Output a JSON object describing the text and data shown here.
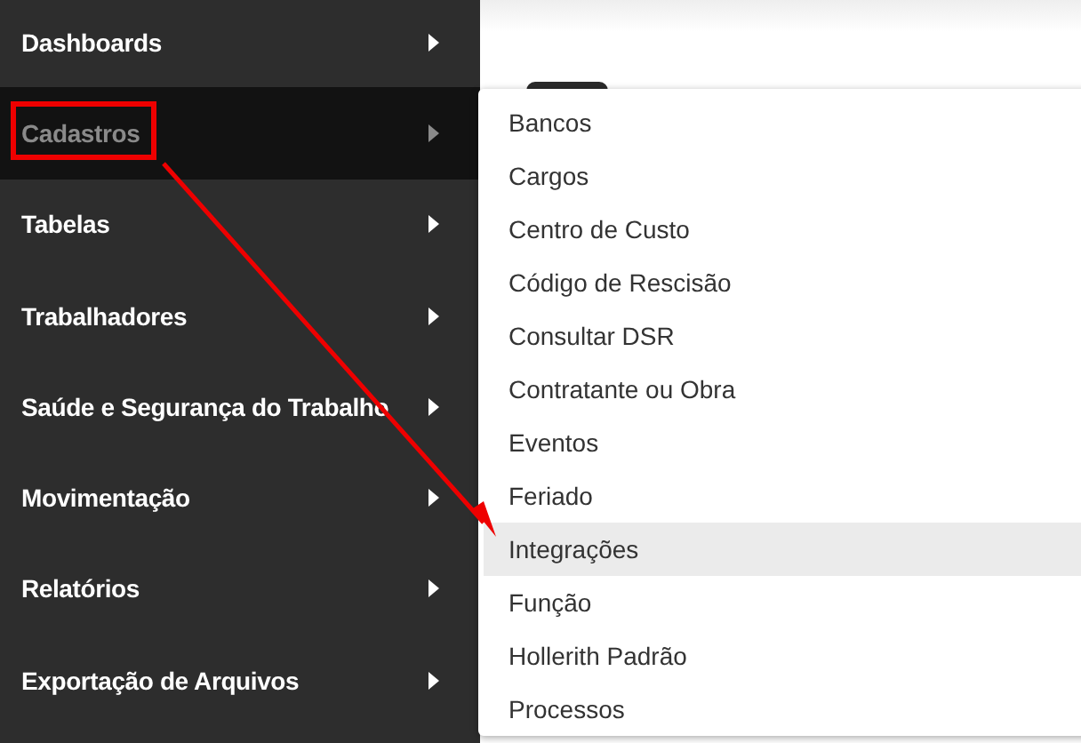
{
  "sidebar": {
    "items": [
      {
        "label": "Dashboards",
        "selected": false
      },
      {
        "label": "Cadastros",
        "selected": true
      },
      {
        "label": "Tabelas",
        "selected": false
      },
      {
        "label": "Trabalhadores",
        "selected": false
      },
      {
        "label": "Saúde e Segurança do Trabalho",
        "selected": false
      },
      {
        "label": "Movimentação",
        "selected": false
      },
      {
        "label": "Relatórios",
        "selected": false
      },
      {
        "label": "Exportação de Arquivos",
        "selected": false
      }
    ]
  },
  "submenu": {
    "items": [
      {
        "label": "Bancos",
        "selected": false
      },
      {
        "label": "Cargos",
        "selected": false
      },
      {
        "label": "Centro de Custo",
        "selected": false
      },
      {
        "label": "Código de Rescisão",
        "selected": false
      },
      {
        "label": "Consultar DSR",
        "selected": false
      },
      {
        "label": "Contratante ou Obra",
        "selected": false
      },
      {
        "label": "Eventos",
        "selected": false
      },
      {
        "label": "Feriado",
        "selected": false
      },
      {
        "label": "Integrações",
        "selected": true
      },
      {
        "label": "Função",
        "selected": false
      },
      {
        "label": "Hollerith Padrão",
        "selected": false
      },
      {
        "label": "Processos",
        "selected": false
      }
    ]
  }
}
